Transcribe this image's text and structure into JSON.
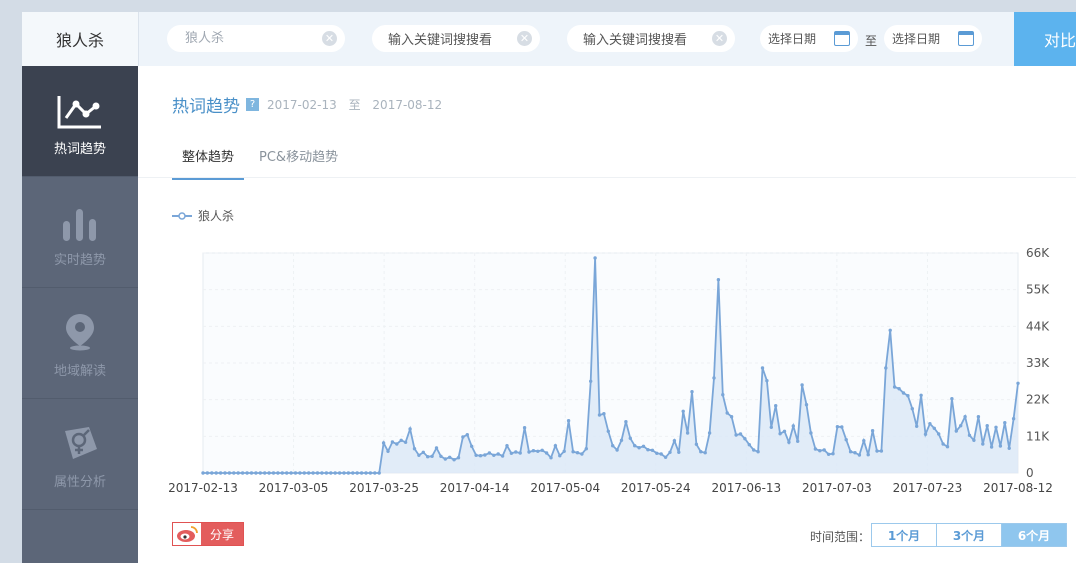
{
  "topbar": {
    "brand": "狼人杀",
    "search1": {
      "placeholder": "狼人杀"
    },
    "search2": {
      "text": "输入关键词搜搜看"
    },
    "search3": {
      "text": "输入关键词搜搜看"
    },
    "date_start": "选择日期",
    "date_to": "至",
    "date_end": "选择日期",
    "compare_label": "对比"
  },
  "sidebar": {
    "items": [
      {
        "label": "热词趋势",
        "icon": "trend-chart-icon",
        "active": true
      },
      {
        "label": "实时趋势",
        "icon": "bar-chart-icon",
        "active": false
      },
      {
        "label": "地域解读",
        "icon": "map-pin-icon",
        "active": false
      },
      {
        "label": "属性分析",
        "icon": "gender-icon",
        "active": false
      }
    ]
  },
  "main": {
    "title": "热词趋势",
    "help": "?",
    "date_from": "2017-02-13",
    "date_sep": "至",
    "date_to": "2017-08-12",
    "tabs": [
      "整体趋势",
      "PC&移动趋势"
    ],
    "share_label": "分享",
    "range_label": "时间范围：",
    "range_options": [
      "1个月",
      "3个月",
      "6个月"
    ]
  },
  "chart_data": {
    "type": "area",
    "series": [
      {
        "name": "狼人杀",
        "color": "#7aa6d8"
      }
    ],
    "x_start": "2017-02-13",
    "x_end": "2017-08-12",
    "x_tick_labels": [
      "2017-02-13",
      "2017-03-05",
      "2017-03-25",
      "2017-04-14",
      "2017-05-04",
      "2017-05-24",
      "2017-06-13",
      "2017-07-03",
      "2017-07-23",
      "2017-08-12"
    ],
    "y_tick_labels": [
      "0",
      "11K",
      "22K",
      "33K",
      "44K",
      "55K",
      "66K"
    ],
    "ylim": [
      0,
      66000
    ],
    "grid": true,
    "values": [
      0,
      0,
      0,
      0,
      0,
      0,
      0,
      0,
      0,
      0,
      0,
      0,
      0,
      0,
      0,
      0,
      0,
      0,
      0,
      0,
      0,
      0,
      0,
      0,
      0,
      0,
      0,
      0,
      0,
      0,
      0,
      0,
      0,
      0,
      0,
      0,
      0,
      0,
      0,
      0,
      0,
      9000,
      6500,
      9300,
      8700,
      9800,
      9200,
      13200,
      7300,
      5300,
      6200,
      4900,
      5000,
      7500,
      5000,
      4200,
      4700,
      4000,
      4600,
      10800,
      11500,
      8000,
      5300,
      5200,
      5400,
      6000,
      5300,
      5700,
      5100,
      8200,
      5900,
      6300,
      6000,
      13600,
      6300,
      6700,
      6500,
      6800,
      6000,
      4600,
      8200,
      5200,
      6500,
      15700,
      6400,
      6100,
      5700,
      7300,
      27500,
      64500,
      17400,
      17800,
      12500,
      8200,
      6900,
      9800,
      15400,
      10400,
      8200,
      7600,
      8000,
      7000,
      6800,
      5900,
      5700,
      4700,
      6200,
      9700,
      6200,
      18500,
      12000,
      24400,
      8600,
      6400,
      6100,
      12000,
      28500,
      58000,
      23500,
      18000,
      16900,
      11400,
      11700,
      10300,
      8500,
      6900,
      6400,
      31500,
      27700,
      13700,
      20200,
      11800,
      12500,
      9200,
      14100,
      9500,
      26400,
      20500,
      12000,
      7200,
      6700,
      6900,
      5600,
      5800,
      13900,
      13800,
      10000,
      6400,
      6100,
      5400,
      9700,
      5500,
      12700,
      6600,
      6600,
      31500,
      42800,
      25800,
      25300,
      24000,
      23200,
      19300,
      14000,
      23300,
      11600,
      14800,
      13400,
      11700,
      8700,
      7900,
      22300,
      12600,
      14200,
      16900,
      11300,
      9800,
      16900,
      8700,
      14200,
      7800,
      13700,
      8100,
      15100,
      7400,
      16300,
      26900
    ]
  }
}
